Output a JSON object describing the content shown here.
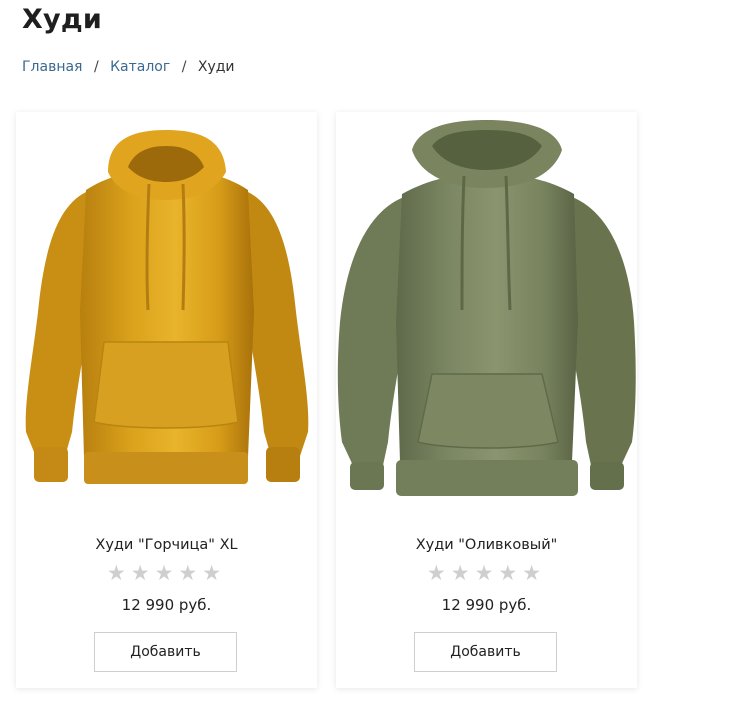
{
  "page": {
    "title": "Худи"
  },
  "breadcrumb": {
    "items": [
      {
        "label": "Главная"
      },
      {
        "label": "Каталог"
      },
      {
        "label": "Худи"
      }
    ],
    "separator": "/"
  },
  "products": [
    {
      "name": "Худи \"Горчица\" XL",
      "price": "12 990 руб.",
      "rating": 0,
      "max_rating": 5,
      "add_label": "Добавить",
      "image_icon": "mustard-hoodie",
      "color": "#e1a51c"
    },
    {
      "name": "Худи \"Оливковый\"",
      "price": "12 990 руб.",
      "rating": 0,
      "max_rating": 5,
      "add_label": "Добавить",
      "image_icon": "olive-hoodie",
      "color": "#7f8a66"
    }
  ],
  "colors": {
    "link": "#3a6a91",
    "star_empty": "#cfcfcf"
  }
}
